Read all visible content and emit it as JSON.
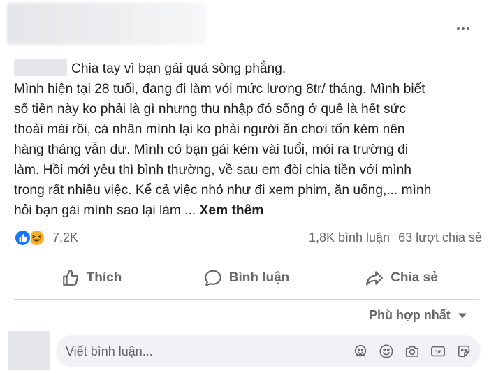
{
  "post": {
    "title": "Chia tay vì bạn gái quá sòng phẳng.",
    "lines": [
      "Mình hiện tại 28 tuổi, đang đi làm vói mức lương 8tr/ tháng. Mình biết",
      "số tiền này ko phải là gì nhưng thu nhập đó sống ở quê là hết sức",
      "thoải mái rồi, cá nhân mình lại ko phải người ăn chơi tốn kém nên",
      "hàng tháng vẫn dư. Mình có bạn gái kém vài tuổi, mói ra trường đi",
      "làm. Hồi mới yêu thì bình thường, về sau em đòi chia tiền với mình",
      "trong rất nhiều việc. Kể cả việc nhỏ như đi xem phim, ăn uống,... mình",
      "hỏi bạn gái mình sao lại làm ..."
    ],
    "see_more": "Xem thêm"
  },
  "stats": {
    "reactions": "7,2K",
    "comments": "1,8K bình luận",
    "shares": "63 lượt chia sẻ"
  },
  "actions": {
    "like": "Thích",
    "comment": "Bình luận",
    "share": "Chia sẻ"
  },
  "sort": {
    "label": "Phù hợp nhất"
  },
  "comment_box": {
    "placeholder": "Viết bình luận..."
  },
  "colors": {
    "accent": "#1877f2",
    "secondary_text": "#65676b",
    "comment_bg": "#f0f2f5",
    "divider": "#ced0d4"
  },
  "icons": [
    "more-icon",
    "like-reaction-icon",
    "haha-reaction-icon",
    "thumbs-up-icon",
    "comment-bubble-icon",
    "share-arrow-icon",
    "chevron-down-icon",
    "avatar-sticker-icon",
    "emoji-icon",
    "camera-icon",
    "gif-icon",
    "sticker-icon"
  ]
}
